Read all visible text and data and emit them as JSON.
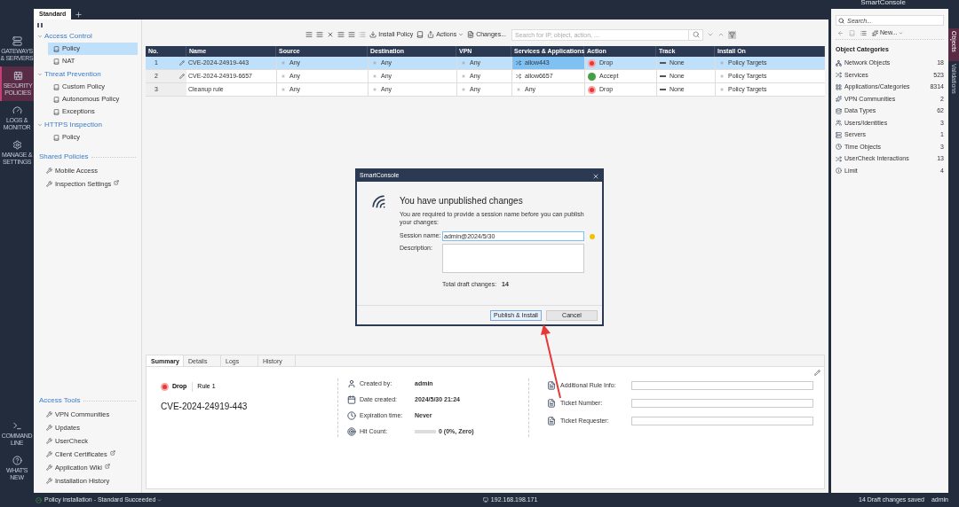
{
  "top_bar": {
    "app_name": "SmartConsole"
  },
  "nav": [
    {
      "label": "GATEWAYS & SERVERS",
      "kind": "gateways",
      "selected": false
    },
    {
      "label": "SECURITY POLICIES",
      "kind": "policies",
      "selected": true
    },
    {
      "label": "LOGS & MONITOR",
      "kind": "logs",
      "selected": false
    },
    {
      "label": "MANAGE & SETTINGS",
      "kind": "manage",
      "selected": false
    }
  ],
  "nav_bottom": [
    {
      "label": "COMMAND LINE",
      "kind": "cli"
    },
    {
      "label": "WHAT'S NEW",
      "kind": "new"
    }
  ],
  "policy_tabs": [
    {
      "label": "Standard",
      "selected": true
    }
  ],
  "tree": [
    {
      "label": "Access Control",
      "expanded": true,
      "children": [
        {
          "label": "Policy",
          "selected": true
        },
        {
          "label": "NAT",
          "selected": false
        }
      ]
    },
    {
      "label": "Threat Prevention",
      "expanded": true,
      "children": [
        {
          "label": "Custom Policy",
          "selected": false
        },
        {
          "label": "Autonomous Policy",
          "selected": false
        },
        {
          "label": "Exceptions",
          "selected": false
        }
      ]
    },
    {
      "label": "HTTPS Inspection",
      "expanded": true,
      "children": [
        {
          "label": "Policy",
          "selected": false
        }
      ]
    }
  ],
  "shared_policies": {
    "title": "Shared Policies",
    "items": [
      {
        "label": "Mobile Access",
        "external": false
      },
      {
        "label": "Inspection Settings",
        "external": true
      }
    ]
  },
  "access_tools": {
    "title": "Access Tools",
    "items": [
      {
        "label": "VPN Communities",
        "external": false
      },
      {
        "label": "Updates",
        "external": false
      },
      {
        "label": "UserCheck",
        "external": false
      },
      {
        "label": "Client Certificates",
        "external": true
      },
      {
        "label": "Application Wiki",
        "external": true
      },
      {
        "label": "Installation History",
        "external": false
      }
    ]
  },
  "toolbar": {
    "install_label": "Install Policy",
    "actions_label": "Actions",
    "changes_label": "Changes...",
    "search_placeholder": "Search for IP, object, action, ..."
  },
  "table": {
    "columns": [
      "No.",
      "Name",
      "Source",
      "Destination",
      "VPN",
      "Services & Applications",
      "Action",
      "Track",
      "Install On"
    ],
    "rows": [
      {
        "no": "1",
        "name": "CVE-2024-24919-443",
        "edited": true,
        "source": "Any",
        "destination": "Any",
        "vpn": "Any",
        "service": {
          "label": "allow443",
          "kind": "service"
        },
        "action": {
          "label": "Drop",
          "kind": "drop"
        },
        "track": "None",
        "install_on": "Policy Targets",
        "selected": true
      },
      {
        "no": "2",
        "name": "CVE-2024-24919-6657",
        "edited": true,
        "source": "Any",
        "destination": "Any",
        "vpn": "Any",
        "service": {
          "label": "allow6657",
          "kind": "service"
        },
        "action": {
          "label": "Accept",
          "kind": "accept"
        },
        "track": "None",
        "install_on": "Policy Targets",
        "selected": false
      },
      {
        "no": "3",
        "name": "Cleanup rule",
        "edited": false,
        "source": "Any",
        "destination": "Any",
        "vpn": "Any",
        "service": {
          "label": "Any",
          "kind": "any"
        },
        "action": {
          "label": "Drop",
          "kind": "drop"
        },
        "track": "None",
        "install_on": "Policy Targets",
        "selected": false
      }
    ]
  },
  "summary": {
    "tabs": [
      {
        "label": "Summary",
        "selected": true
      },
      {
        "label": "Details",
        "selected": false
      },
      {
        "label": "Logs",
        "selected": false
      },
      {
        "label": "History",
        "selected": false
      }
    ],
    "action": {
      "label": "Drop",
      "kind": "drop"
    },
    "rule_label": "Rule",
    "rule_no": "1",
    "rule_name": "CVE-2024-24919-443",
    "info": [
      {
        "label": "Created by:",
        "value": "admin",
        "kind": "user"
      },
      {
        "label": "Date created:",
        "value": "2024/5/30 21:24",
        "kind": "date"
      },
      {
        "label": "Expiration time:",
        "value": "Never",
        "kind": "clock"
      },
      {
        "label": "Hit Count:",
        "value": "0 (0%, Zero)",
        "kind": "hits",
        "level": 0
      }
    ],
    "fields": [
      {
        "label": "Additional Rule Info:"
      },
      {
        "label": "Ticket Number:"
      },
      {
        "label": "Ticket Requester:"
      }
    ]
  },
  "objects_panel": {
    "search_placeholder": "Search...",
    "new_label": "New...",
    "title": "Object Categories",
    "categories": [
      {
        "label": "Network Objects",
        "count": "18",
        "kind": "network"
      },
      {
        "label": "Services",
        "count": "523",
        "kind": "services"
      },
      {
        "label": "Applications/Categories",
        "count": "8314",
        "kind": "apps"
      },
      {
        "label": "VPN Communities",
        "count": "2",
        "kind": "vpn"
      },
      {
        "label": "Data Types",
        "count": "62",
        "kind": "data"
      },
      {
        "label": "Users/Identities",
        "count": "3",
        "kind": "users"
      },
      {
        "label": "Servers",
        "count": "1",
        "kind": "servers"
      },
      {
        "label": "Time Objects",
        "count": "3",
        "kind": "time"
      },
      {
        "label": "UserCheck Interactions",
        "count": "13",
        "kind": "usercheck"
      },
      {
        "label": "Limit",
        "count": "4",
        "kind": "limit"
      }
    ]
  },
  "side_tabs": [
    {
      "label": "Objects",
      "selected": true
    },
    {
      "label": "Validations",
      "selected": false
    }
  ],
  "status_bar": {
    "message": "Policy installation - Standard Succeeded",
    "ip": "192.168.198.171",
    "drafts": "14 Draft changes saved",
    "user": "admin"
  },
  "dialog": {
    "title": "SmartConsole",
    "heading": "You have unpublished changes",
    "message": "You are required to provide a session name before you can publish your changes:",
    "session_label": "Session name:",
    "session_value": "admin@2024/5/30",
    "description_label": "Description:",
    "total_label": "Total draft changes:",
    "total_value": "14",
    "buttons": [
      {
        "label": "Publish & Install",
        "kind": "primary"
      },
      {
        "label": "Cancel",
        "kind": "secondary"
      }
    ]
  },
  "overlay_arrow": true
}
